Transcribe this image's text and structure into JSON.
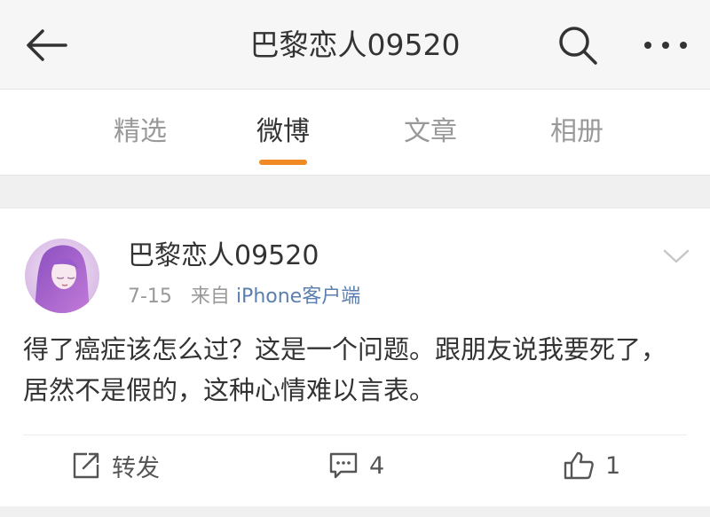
{
  "header": {
    "title": "巴黎恋人09520",
    "back_icon": "back-arrow-icon",
    "search_icon": "search-icon",
    "more_icon": "more-dots-icon"
  },
  "tabs": [
    {
      "label": "精选",
      "active": false
    },
    {
      "label": "微博",
      "active": true
    },
    {
      "label": "文章",
      "active": false
    },
    {
      "label": "相册",
      "active": false
    }
  ],
  "accent_color": "#f08a24",
  "post": {
    "author": "巴黎恋人09520",
    "date": "7-15",
    "from_label": "来自",
    "source": "iPhone客户端",
    "text": "得了癌症该怎么过？这是一个问题。跟朋友说我要死了，居然不是假的，这种心情难以言表。",
    "actions": {
      "repost_label": "转发",
      "comment_count": "4",
      "like_count": "1"
    }
  }
}
